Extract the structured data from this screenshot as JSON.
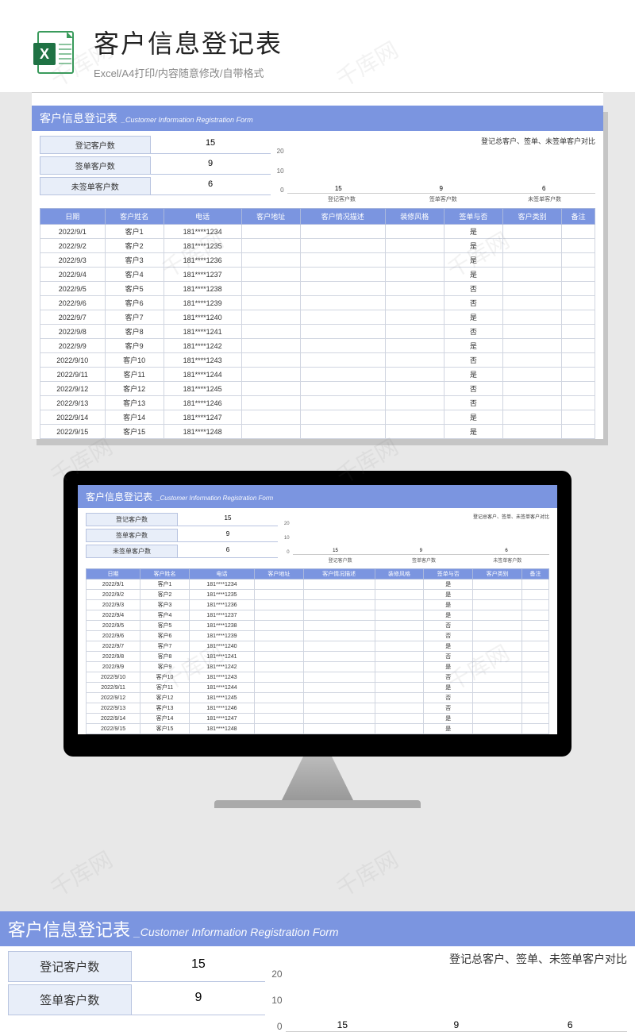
{
  "header": {
    "main_title": "客户信息登记表",
    "sub_title": "Excel/A4打印/内容随意修改/自带格式"
  },
  "form": {
    "title_zh": "客户信息登记表",
    "title_en": "_Customer Information Registration Form"
  },
  "summary": {
    "items": [
      {
        "label": "登记客户数",
        "value": "15"
      },
      {
        "label": "签单客户数",
        "value": "9"
      },
      {
        "label": "未签单客户数",
        "value": "6"
      }
    ]
  },
  "chart_data": {
    "type": "bar",
    "title": "登记总客户、签单、未签单客户对比",
    "categories": [
      "登记客户数",
      "签单客户数",
      "未签单客户数"
    ],
    "values": [
      15,
      9,
      6
    ],
    "colors": [
      "#6a8de8",
      "#f4c430",
      "#e85a5a"
    ],
    "ylim": [
      0,
      20
    ],
    "y_ticks": [
      20,
      10,
      0
    ],
    "ylabel": "",
    "xlabel": ""
  },
  "table": {
    "headers": [
      "日期",
      "客户姓名",
      "电话",
      "客户地址",
      "客户情况描述",
      "装修风格",
      "签单与否",
      "客户类别",
      "备注"
    ],
    "rows": [
      [
        "2022/9/1",
        "客户1",
        "181****1234",
        "",
        "",
        "",
        "是",
        "",
        ""
      ],
      [
        "2022/9/2",
        "客户2",
        "181****1235",
        "",
        "",
        "",
        "是",
        "",
        ""
      ],
      [
        "2022/9/3",
        "客户3",
        "181****1236",
        "",
        "",
        "",
        "是",
        "",
        ""
      ],
      [
        "2022/9/4",
        "客户4",
        "181****1237",
        "",
        "",
        "",
        "是",
        "",
        ""
      ],
      [
        "2022/9/5",
        "客户5",
        "181****1238",
        "",
        "",
        "",
        "否",
        "",
        ""
      ],
      [
        "2022/9/6",
        "客户6",
        "181****1239",
        "",
        "",
        "",
        "否",
        "",
        ""
      ],
      [
        "2022/9/7",
        "客户7",
        "181****1240",
        "",
        "",
        "",
        "是",
        "",
        ""
      ],
      [
        "2022/9/8",
        "客户8",
        "181****1241",
        "",
        "",
        "",
        "否",
        "",
        ""
      ],
      [
        "2022/9/9",
        "客户9",
        "181****1242",
        "",
        "",
        "",
        "是",
        "",
        ""
      ],
      [
        "2022/9/10",
        "客户10",
        "181****1243",
        "",
        "",
        "",
        "否",
        "",
        ""
      ],
      [
        "2022/9/11",
        "客户11",
        "181****1244",
        "",
        "",
        "",
        "是",
        "",
        ""
      ],
      [
        "2022/9/12",
        "客户12",
        "181****1245",
        "",
        "",
        "",
        "否",
        "",
        ""
      ],
      [
        "2022/9/13",
        "客户13",
        "181****1246",
        "",
        "",
        "",
        "否",
        "",
        ""
      ],
      [
        "2022/9/14",
        "客户14",
        "181****1247",
        "",
        "",
        "",
        "是",
        "",
        ""
      ],
      [
        "2022/9/15",
        "客户15",
        "181****1248",
        "",
        "",
        "",
        "是",
        "",
        ""
      ]
    ]
  },
  "watermark": "千库网"
}
